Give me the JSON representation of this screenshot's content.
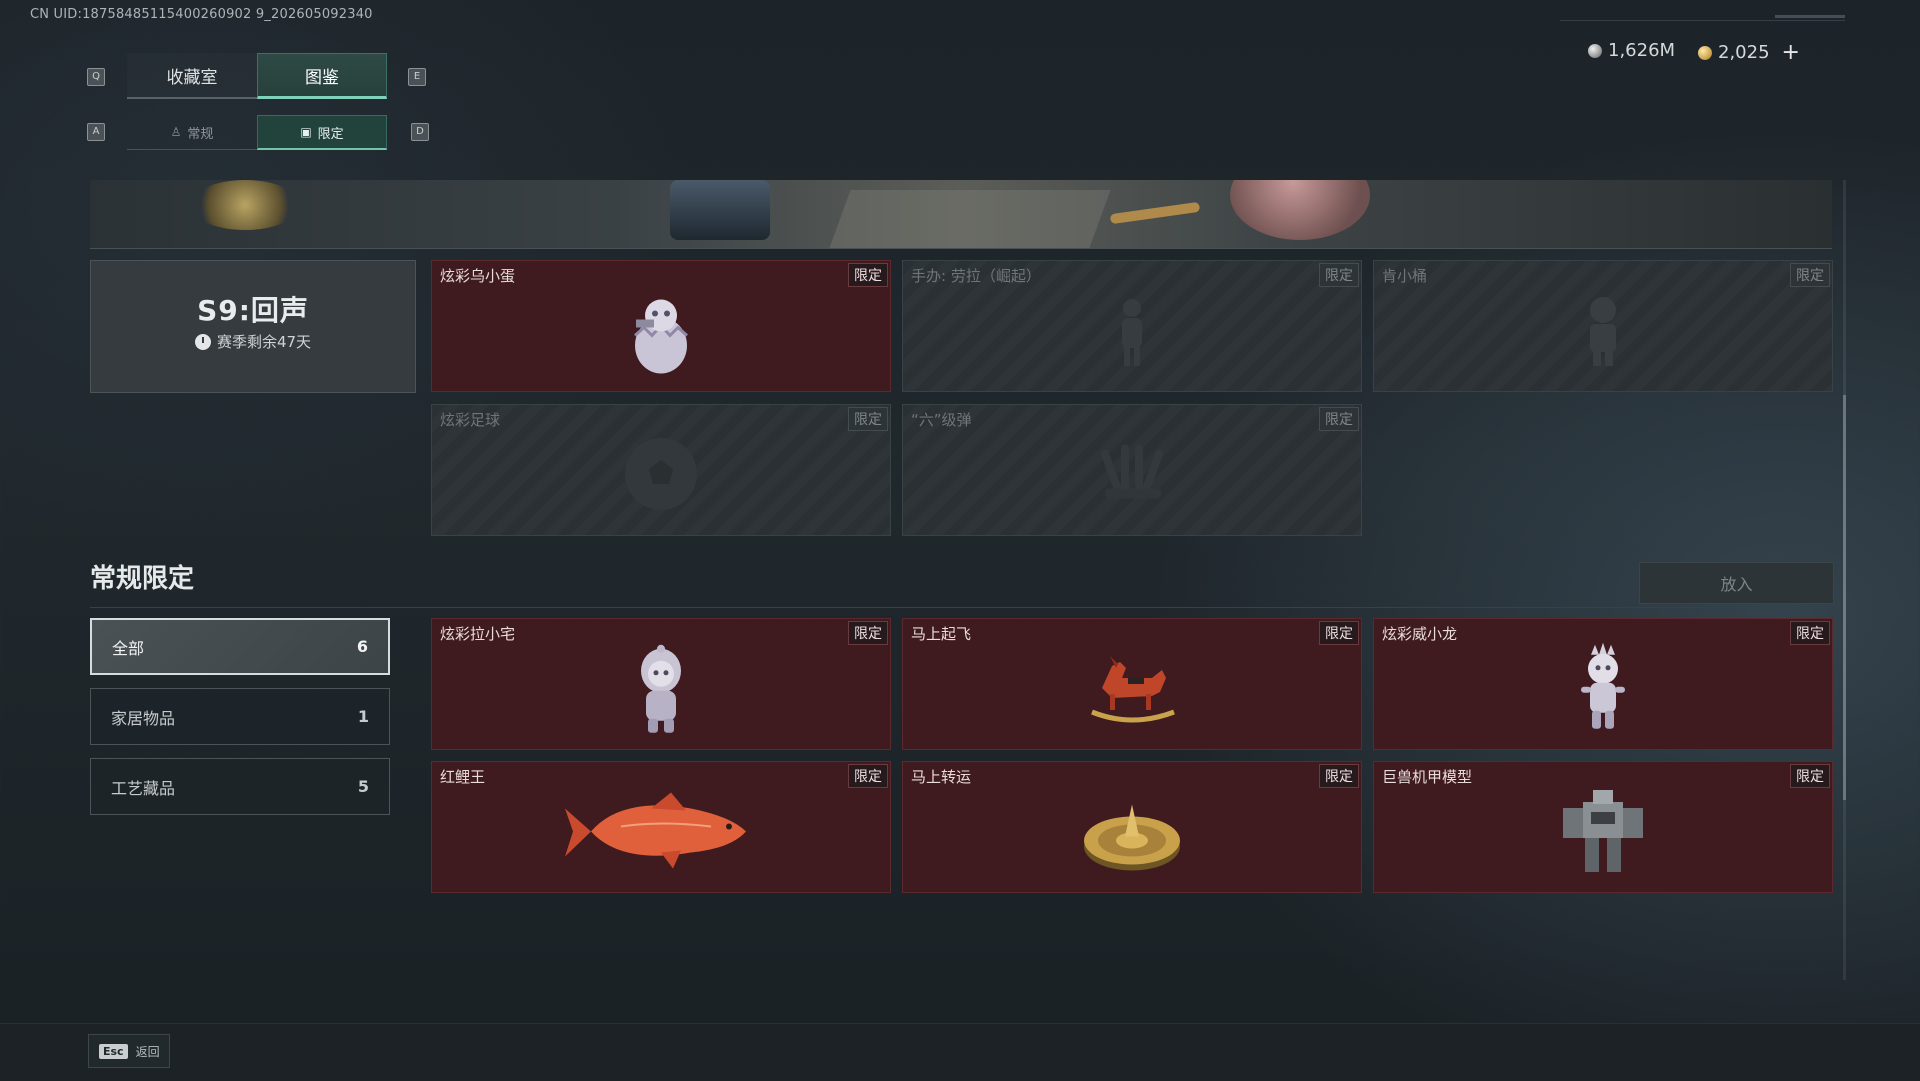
{
  "uid": "CN UID:18758485115400260902 9_202605092340",
  "currencies": [
    {
      "icon": "silver-coin-icon",
      "value": "1,626M"
    },
    {
      "icon": "gold-coin-icon",
      "value": "2,025"
    }
  ],
  "add_label": "+",
  "keys": {
    "q": "Q",
    "e": "E",
    "a": "A",
    "d": "D"
  },
  "tabs": [
    {
      "label": "收藏室",
      "active": false
    },
    {
      "label": "图鉴",
      "active": true
    }
  ],
  "subtabs": [
    {
      "label": "常规",
      "icon": "figure-icon",
      "active": false
    },
    {
      "label": "限定",
      "icon": "image-icon",
      "active": true
    }
  ],
  "season": {
    "title": "S9:回声",
    "remaining": "赛季剩余47天"
  },
  "season_items": [
    {
      "name": "炫彩乌小蛋",
      "tag": "限定",
      "owned": true
    },
    {
      "name": "手办: 劳拉（崛起）",
      "tag": "限定",
      "owned": false
    },
    {
      "name": "肯小桶",
      "tag": "限定",
      "owned": false
    },
    {
      "name": "炫彩足球",
      "tag": "限定",
      "owned": false
    },
    {
      "name": "“六”级弹",
      "tag": "限定",
      "owned": false
    }
  ],
  "section": {
    "title": "常规限定",
    "put_label": "放入"
  },
  "filters": [
    {
      "label": "全部",
      "count": "6",
      "active": true
    },
    {
      "label": "家居物品",
      "count": "1",
      "active": false
    },
    {
      "label": "工艺藏品",
      "count": "5",
      "active": false
    }
  ],
  "regular_items": [
    {
      "name": "炫彩拉小宅",
      "tag": "限定",
      "owned": true
    },
    {
      "name": "马上起飞",
      "tag": "限定",
      "owned": true
    },
    {
      "name": "炫彩威小龙",
      "tag": "限定",
      "owned": true
    },
    {
      "name": "红鲤王",
      "tag": "限定",
      "owned": true
    },
    {
      "name": "马上转运",
      "tag": "限定",
      "owned": true
    },
    {
      "name": "巨兽机甲模型",
      "tag": "限定",
      "owned": true
    }
  ],
  "footer": {
    "esc_key": "Esc",
    "back_label": "返回"
  }
}
